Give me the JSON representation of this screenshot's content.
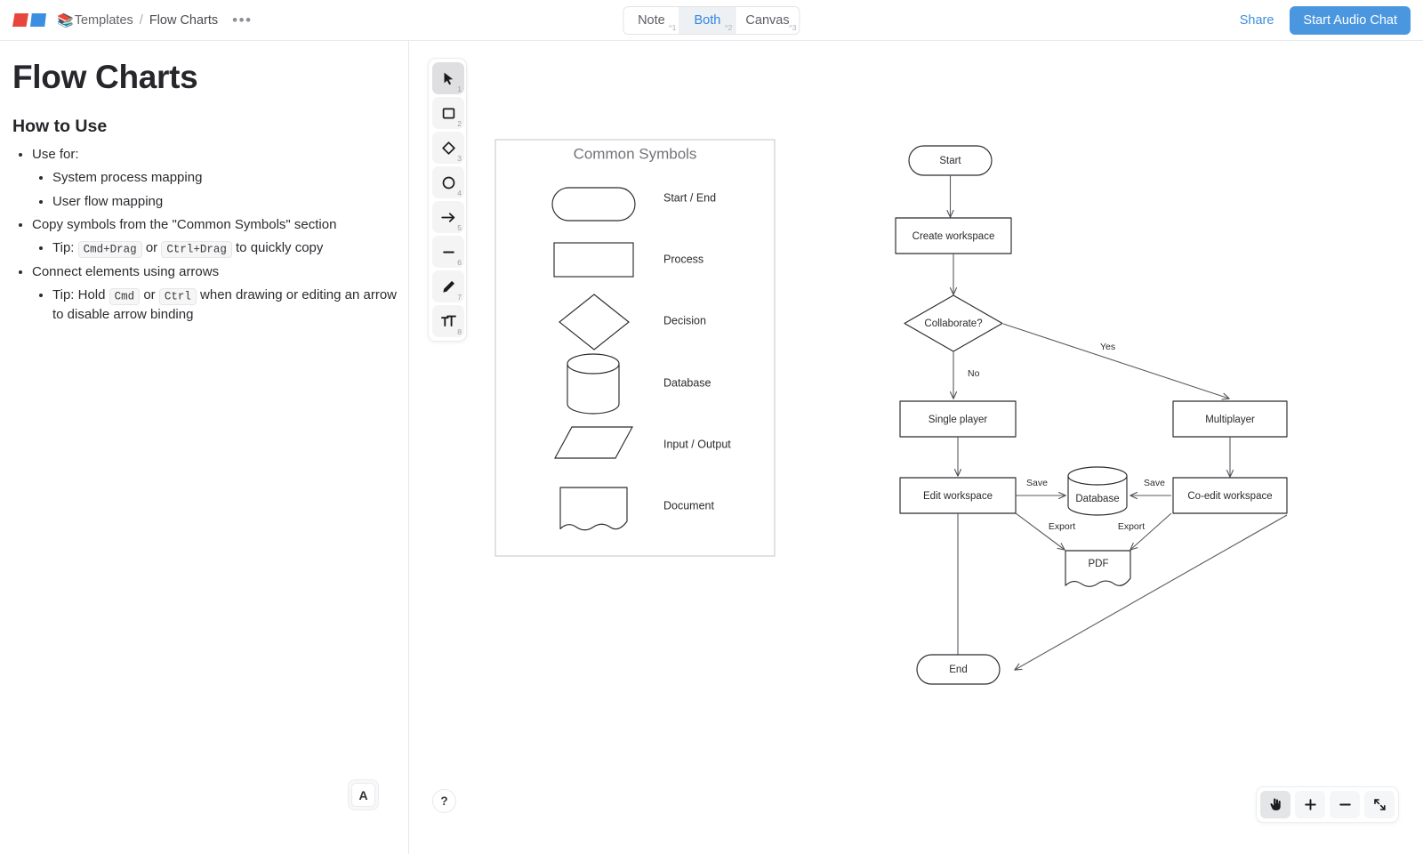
{
  "topbar": {
    "logo_name": "app-logo",
    "breadcrumb": {
      "emoji": "📚",
      "parent": "Templates",
      "separator": "/",
      "current": "Flow Charts",
      "more": "•••"
    },
    "tabs": [
      {
        "label": "Note",
        "shortcut": "^1",
        "active": false
      },
      {
        "label": "Both",
        "shortcut": "^2",
        "active": true
      },
      {
        "label": "Canvas",
        "shortcut": "^3",
        "active": false
      }
    ],
    "share_label": "Share",
    "audio_chat_label": "Start Audio Chat",
    "accent_color": "#4a97e0",
    "link_color": "#3d8fdd"
  },
  "note": {
    "title": "Flow Charts",
    "heading": "How to Use",
    "bullets": {
      "use_for": "Use for:",
      "use_for_sub_1": "System process mapping",
      "use_for_sub_2": "User flow mapping",
      "copy_symbols": "Copy symbols from the \"Common Symbols\" section",
      "copy_tip_prefix": "Tip:",
      "copy_tip_key_1": "Cmd+Drag",
      "copy_tip_or": "or",
      "copy_tip_key_2": "Ctrl+Drag",
      "copy_tip_suffix": "to quickly copy",
      "connect_elements": "Connect elements using arrows",
      "connect_tip_prefix": "Tip: Hold",
      "connect_tip_key_1": "Cmd",
      "connect_tip_or": "or",
      "connect_tip_key_2": "Ctrl",
      "connect_tip_suffix": "when drawing or editing an arrow to disable arrow binding"
    },
    "font_button_label": "A"
  },
  "toolbar": {
    "tools": [
      {
        "name": "selection-tool",
        "num": "1",
        "active": true
      },
      {
        "name": "rectangle-tool",
        "num": "2",
        "active": false
      },
      {
        "name": "diamond-tool",
        "num": "3",
        "active": false
      },
      {
        "name": "ellipse-tool",
        "num": "4",
        "active": false
      },
      {
        "name": "arrow-tool",
        "num": "5",
        "active": false
      },
      {
        "name": "line-tool",
        "num": "6",
        "active": false
      },
      {
        "name": "draw-tool",
        "num": "7",
        "active": false
      },
      {
        "name": "text-tool",
        "num": "8",
        "active": false
      }
    ]
  },
  "canvas_controls": {
    "help_label": "?",
    "zoom_buttons": [
      {
        "name": "pan-hand-button",
        "label": ""
      },
      {
        "name": "zoom-in-button",
        "label": "+"
      },
      {
        "name": "zoom-out-button",
        "label": "−"
      },
      {
        "name": "fit-screen-button",
        "label": ""
      }
    ]
  },
  "legend_panel": {
    "title": "Common Symbols",
    "rows": [
      {
        "shape": "rounded-rectangle",
        "label": "Start / End"
      },
      {
        "shape": "rectangle",
        "label": "Process"
      },
      {
        "shape": "diamond",
        "label": "Decision"
      },
      {
        "shape": "cylinder",
        "label": "Database"
      },
      {
        "shape": "parallelogram",
        "label": "Input / Output"
      },
      {
        "shape": "document",
        "label": "Document"
      }
    ]
  },
  "flowchart": {
    "nodes": {
      "start": "Start",
      "create_workspace": "Create workspace",
      "collaborate": "Collaborate?",
      "single_player": "Single player",
      "multiplayer": "Multiplayer",
      "edit_workspace": "Edit workspace",
      "coedit_workspace": "Co-edit workspace",
      "database": "Database",
      "pdf": "PDF",
      "end": "End"
    },
    "edge_labels": {
      "yes": "Yes",
      "no": "No",
      "save_left": "Save",
      "save_right": "Save",
      "export_left": "Export",
      "export_right": "Export"
    }
  }
}
